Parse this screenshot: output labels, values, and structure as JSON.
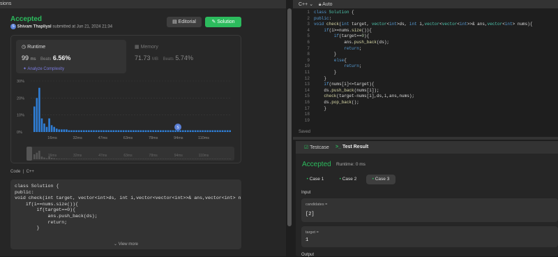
{
  "left_header": {
    "title": "sions"
  },
  "submission": {
    "status": "Accepted",
    "avatar_letter": "S",
    "author": "Shivam Thapliyal",
    "submitted_text": "submitted at Jun 21, 2024 21:34",
    "editorial_label": "Editorial",
    "solution_label": "Solution"
  },
  "runtime": {
    "title": "Runtime",
    "value": "99",
    "unit": "ms",
    "beats_label": "Beats",
    "beats_pct": "6.56%",
    "analyze": "Analyze Complexity"
  },
  "memory": {
    "title": "Memory",
    "value": "71.73",
    "unit": "MB",
    "beats_label": "Beats",
    "beats_pct": "5.74%"
  },
  "chart_data": {
    "type": "bar",
    "y_ticks": [
      "30%",
      "20%",
      "10%",
      "0%"
    ],
    "ylim": [
      0,
      30
    ],
    "x_ticks": [
      "16ms",
      "32ms",
      "47ms",
      "63ms",
      "78ms",
      "94ms",
      "110ms"
    ],
    "values": [
      15,
      20,
      26,
      8,
      5,
      3,
      8,
      4,
      3,
      2,
      1.5,
      1.5,
      1.5,
      1.5,
      1,
      1,
      1,
      1,
      1,
      1,
      1,
      1,
      1,
      1,
      1,
      1,
      1,
      1,
      1,
      1,
      1,
      1,
      1,
      1,
      1,
      1,
      1,
      1,
      1,
      1,
      1,
      1,
      1,
      1,
      1,
      1,
      1,
      1,
      1,
      1,
      1,
      1,
      1,
      1,
      1,
      1,
      1,
      1,
      1,
      1,
      1,
      1,
      1,
      1,
      1,
      1,
      1,
      1,
      1,
      1,
      1,
      1,
      1,
      1,
      1,
      1,
      1,
      1,
      1,
      1
    ],
    "marker_label": "S",
    "marker_ms": 94,
    "colors": {
      "bar": "#2f7fd8",
      "marker": "#5a7fd6"
    }
  },
  "code_section": {
    "label": "Code",
    "lang": "C++",
    "lines": [
      "class Solution {",
      "public:",
      "void check(int target, vector<int>ds, int i,vector<vector<int>>& ans,vector<int> n",
      "    if(i==nums.size()){",
      "        if(target==0){",
      "            ans.push_back(ds);",
      "            return;",
      "        }"
    ],
    "view_more": "View more"
  },
  "editor": {
    "language": "C++",
    "mode": "Auto",
    "saved": "Saved",
    "line_numbers": [
      "1",
      "2",
      "3",
      "4",
      "5",
      "6",
      "7",
      "8",
      "9",
      "10",
      "11",
      "12",
      "13",
      "14",
      "15",
      "16",
      "17",
      "18",
      "19"
    ],
    "lines": [
      "class Solution {",
      "public:",
      "void check(int target, vector<int>ds, int i,vector<vector<int>>& ans,vector<int> nums){",
      "    if(i>=nums.size()){",
      "        if(target==0){",
      "            ans.push_back(ds);",
      "            return;",
      "        }",
      "        else{",
      "            return;",
      "        }",
      "    }",
      "    if(nums[i]<=target){",
      "    ds.push_back(nums[i]);",
      "    check(target-nums[i],ds,i,ans,nums);",
      "    ds.pop_back();",
      "    }",
      "",
      ""
    ]
  },
  "testpanel": {
    "tab_testcase": "Testcase",
    "tab_result": "Test Result",
    "status": "Accepted",
    "runtime": "Runtime: 0 ms",
    "cases": [
      "Case 1",
      "Case 2",
      "Case 3"
    ],
    "input_label": "Input",
    "inputs": [
      {
        "name": "candidates =",
        "value": "[2]"
      },
      {
        "name": "target =",
        "value": "1"
      }
    ],
    "output_label": "Output"
  }
}
